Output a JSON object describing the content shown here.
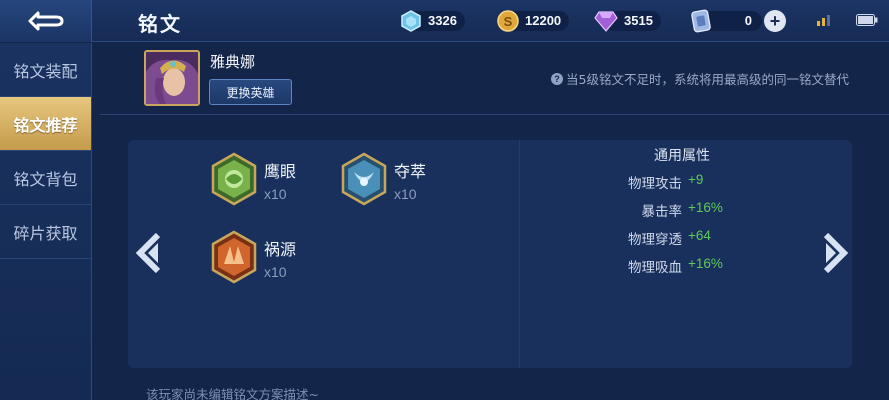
{
  "header": {
    "title": "铭文",
    "resources": [
      {
        "name": "diamond",
        "icon": "diamond-icon",
        "value": "3326"
      },
      {
        "name": "gold",
        "icon": "gold-coin-icon",
        "value": "12200"
      },
      {
        "name": "gem",
        "icon": "purple-gem-icon",
        "value": "3515"
      },
      {
        "name": "coupon",
        "icon": "coupon-icon",
        "value": "0"
      }
    ],
    "plus": "+"
  },
  "sidebar": {
    "items": [
      {
        "label": "铭文装配",
        "active": false
      },
      {
        "label": "铭文推荐",
        "active": true
      },
      {
        "label": "铭文背包",
        "active": false
      },
      {
        "label": "碎片获取",
        "active": false
      }
    ]
  },
  "hero": {
    "name": "雅典娜",
    "change_label": "更换英雄"
  },
  "tip": {
    "icon": "?",
    "text": "当5级铭文不足时，系统将用最高级的同一铭文替代"
  },
  "runes": [
    {
      "name": "鹰眼",
      "count": "x10",
      "color": "#7bb04a"
    },
    {
      "name": "夺萃",
      "count": "x10",
      "color": "#4a8fb8"
    },
    {
      "name": "祸源",
      "count": "x10",
      "color": "#d0662d"
    }
  ],
  "stats": {
    "title": "通用属性",
    "rows": [
      {
        "label": "物理攻击",
        "value": "+9"
      },
      {
        "label": "暴击率",
        "value": "+16%"
      },
      {
        "label": "物理穿透",
        "value": "+64"
      },
      {
        "label": "物理吸血",
        "value": "+16%"
      }
    ]
  },
  "footer": {
    "note": "该玩家尚未编辑铭文方案描述~"
  },
  "colors": {
    "accent_gold": "#c9a55f",
    "stat_green": "#5ec95a",
    "background": "#14254a"
  }
}
